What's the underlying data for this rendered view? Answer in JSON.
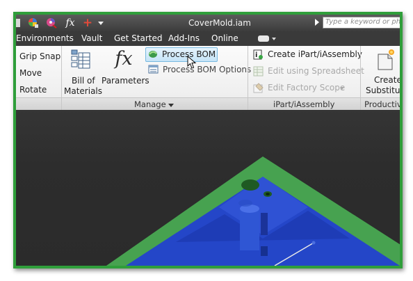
{
  "window": {
    "title": "CoverMold.iam",
    "search_placeholder": "Type a keyword or phrase"
  },
  "quick_access": {
    "icons": [
      "color-wheel-icon",
      "appearance-icon",
      "function-icon",
      "add-icon",
      "dropdown-icon"
    ],
    "fx_glyph": "fx",
    "plus_glyph": "+"
  },
  "tabs": [
    "Environments",
    "Vault",
    "Get Started",
    "Add-Ins",
    "Online"
  ],
  "ribbon": {
    "position_group": {
      "grip_snap": "Grip Snap",
      "move": "Move",
      "rotate": "Rotate"
    },
    "manage_panel": {
      "bill_of_materials_line1": "Bill of",
      "bill_of_materials_line2": "Materials",
      "parameters": "Parameters",
      "fx_glyph": "fx",
      "process_bom": "Process BOM",
      "process_bom_options": "Process BOM Options",
      "panel_title": "Manage"
    },
    "ipart_panel": {
      "create_ipart": "Create iPart/iAssembly",
      "edit_spreadsheet": "Edit using Spreadsheet",
      "edit_factory_scope": "Edit Factory Scope",
      "panel_title": "iPart/iAssembly"
    },
    "productivity_panel": {
      "create_line1": "Create",
      "create_line2": "Substitutes",
      "panel_title": "Productivity"
    }
  },
  "colors": {
    "frame_green": "#2f9e3a",
    "model_green": "#3f9e49",
    "model_blue": "#2446c8",
    "ribbon_bg": "#f4f4f4",
    "titlebar_bg": "#4a4a4a"
  }
}
